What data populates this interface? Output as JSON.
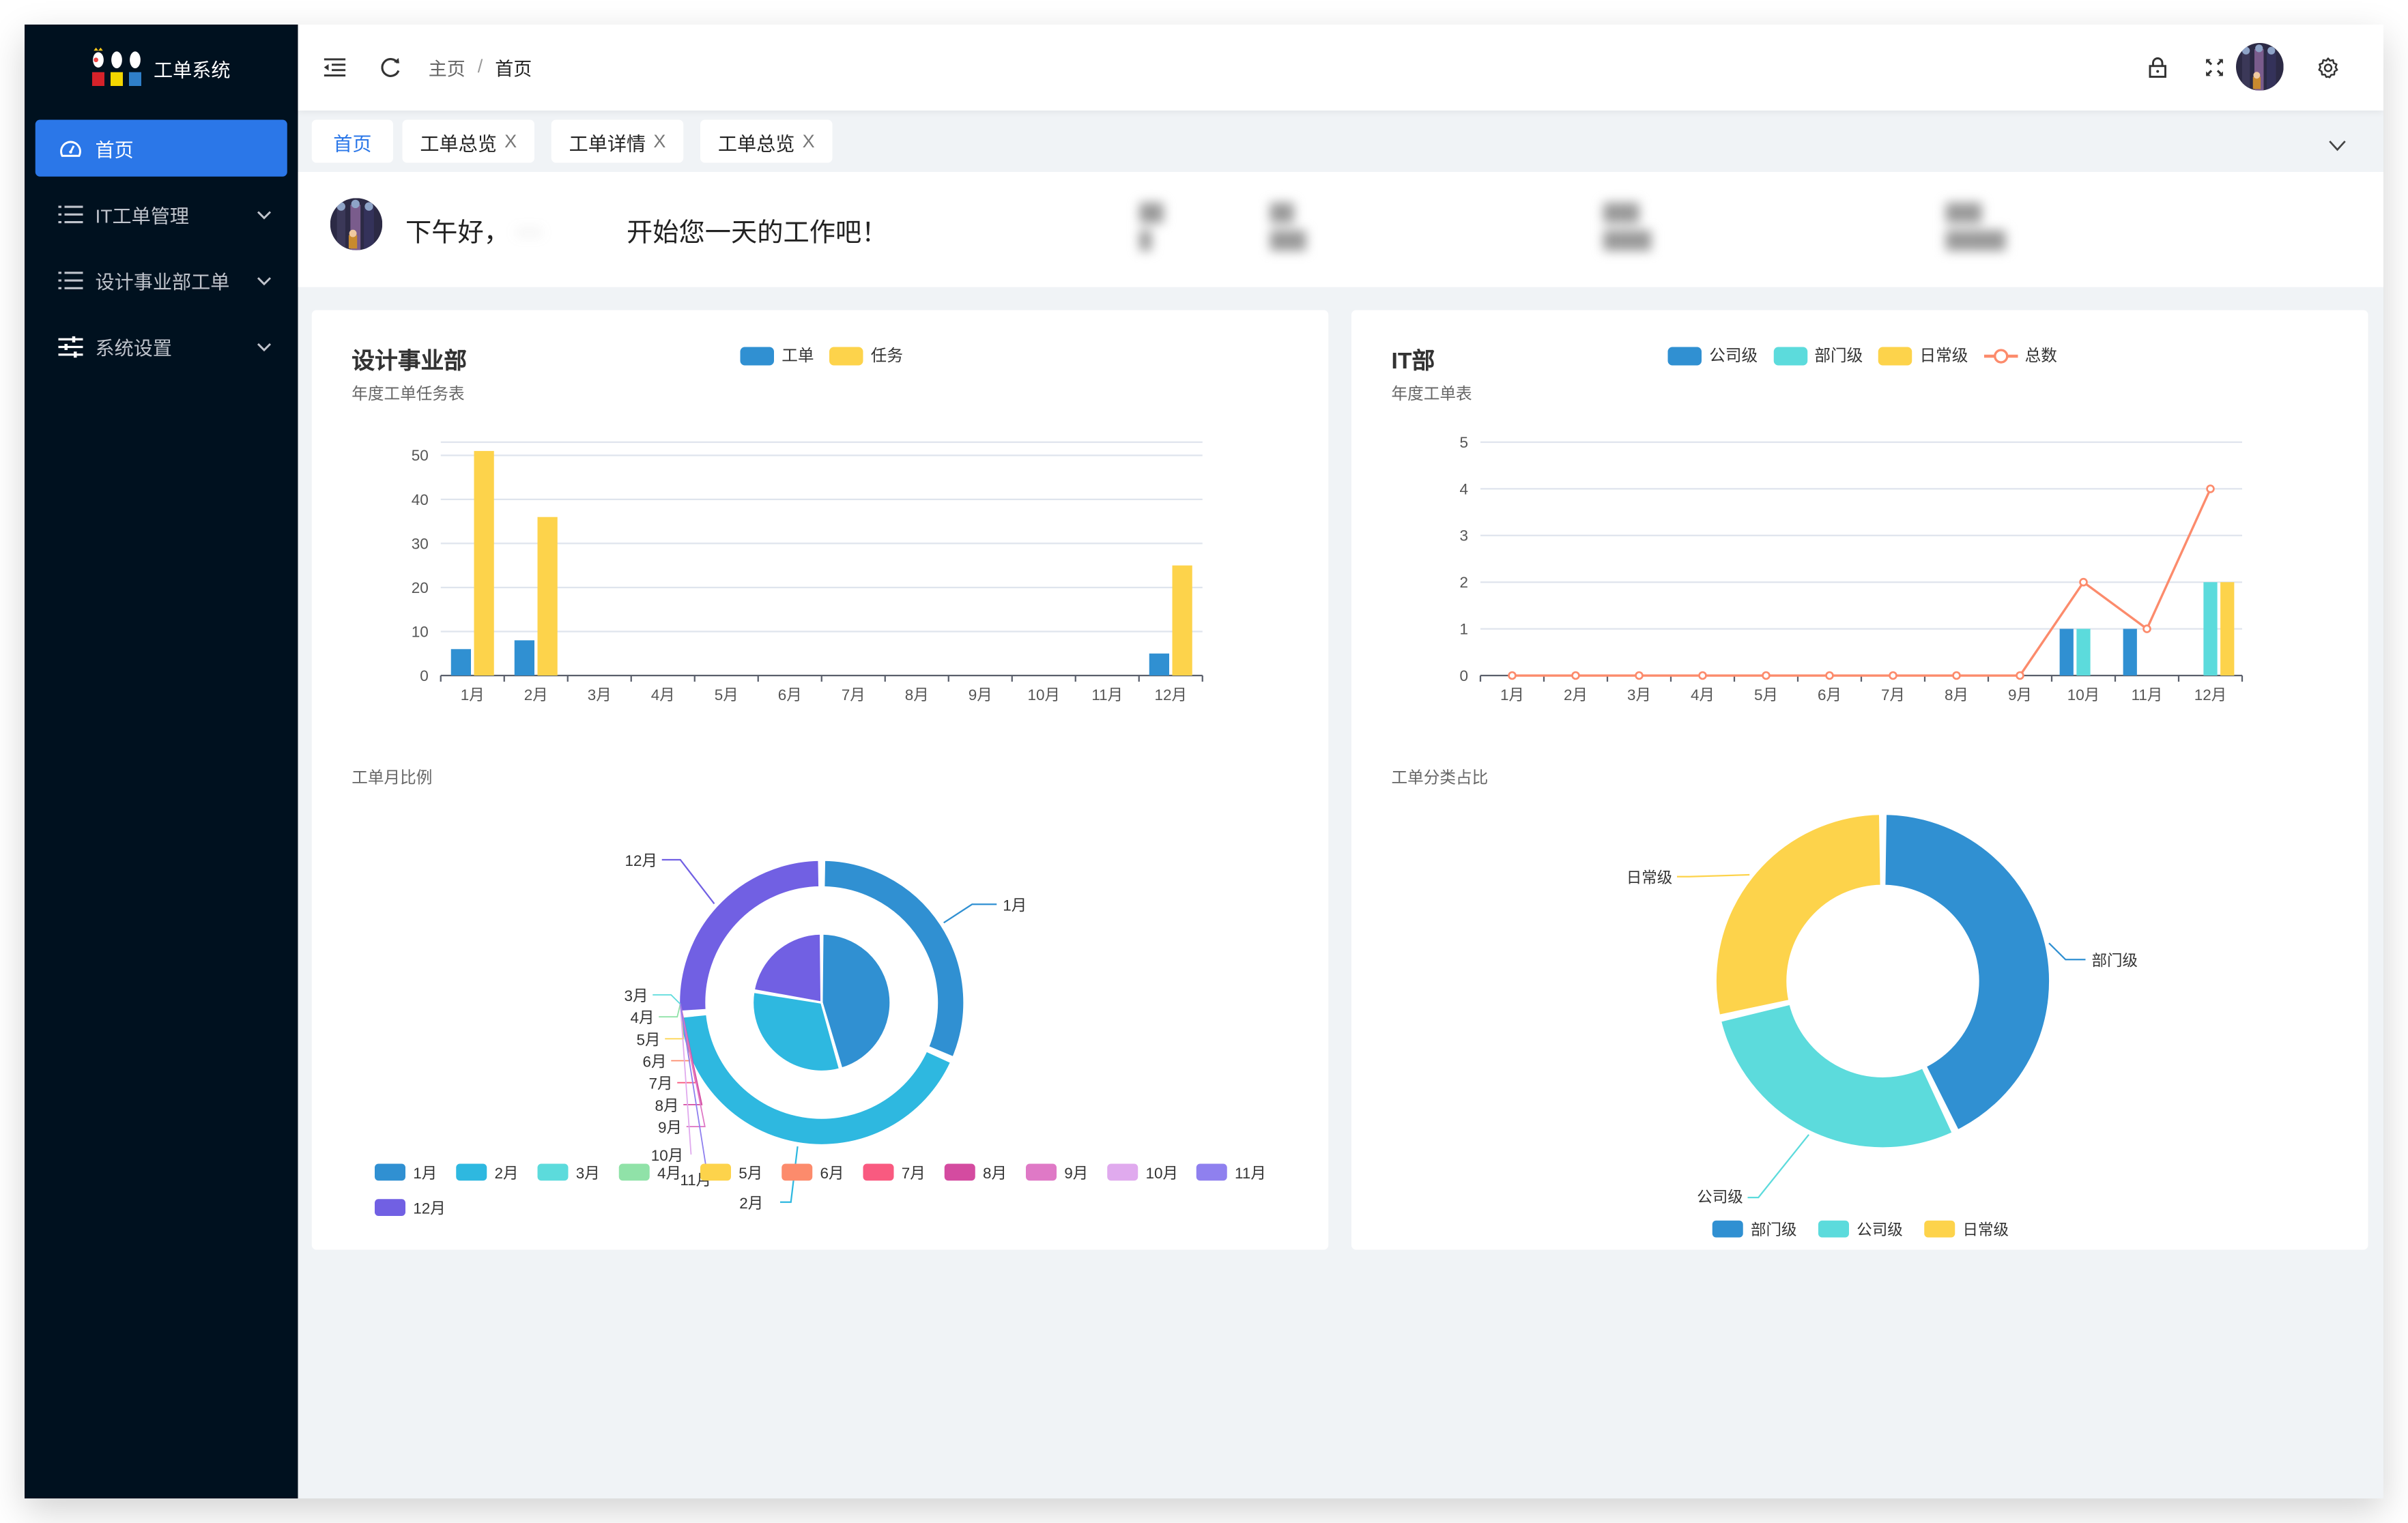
{
  "app": {
    "title": "工单系统"
  },
  "sidebar": {
    "items": [
      {
        "label": "首页",
        "icon": "dashboard-icon",
        "active": true,
        "expandable": false
      },
      {
        "label": "IT工单管理",
        "icon": "list-icon",
        "active": false,
        "expandable": true
      },
      {
        "label": "设计事业部工单",
        "icon": "list-icon",
        "active": false,
        "expandable": true
      },
      {
        "label": "系统设置",
        "icon": "sliders-icon",
        "active": false,
        "expandable": true
      }
    ]
  },
  "header": {
    "breadcrumb": [
      "主页",
      "首页"
    ],
    "separator": "/",
    "icons": [
      "collapse-menu-icon",
      "refresh-icon",
      "lock-icon",
      "fullscreen-icon",
      "avatar",
      "settings-icon"
    ]
  },
  "tabs": [
    {
      "label": "首页",
      "active": true,
      "closable": false
    },
    {
      "label": "工单总览",
      "active": false,
      "closable": true
    },
    {
      "label": "工单详情",
      "active": false,
      "closable": true
    },
    {
      "label": "工单总览",
      "active": false,
      "closable": true
    }
  ],
  "tab_close_glyph": "X",
  "greeting": {
    "prefix": "下午好，",
    "name": "···",
    "suffix": "开始您一天的工作吧！",
    "stats_blurred": true
  },
  "colors": {
    "accent": "#2b77e8",
    "sidebar_bg": "#00111f",
    "blue": "#3090d2",
    "cyan": "#2eb8e0",
    "teal": "#5cdbdc",
    "yellow": "#fdd34b",
    "line": "#fc8b6c",
    "purple": "#7160e3"
  },
  "chart_data": [
    {
      "type": "bar",
      "title": "设计事业部",
      "subtitle": "年度工单任务表",
      "categories": [
        "1月",
        "2月",
        "3月",
        "4月",
        "5月",
        "6月",
        "7月",
        "8月",
        "9月",
        "10月",
        "11月",
        "12月"
      ],
      "series": [
        {
          "name": "工单",
          "color": "#3090d2",
          "values": [
            6,
            8,
            0,
            0,
            0,
            0,
            0,
            0,
            0,
            0,
            0,
            5
          ]
        },
        {
          "name": "任务",
          "color": "#fdd34b",
          "values": [
            51,
            36,
            0,
            0,
            0,
            0,
            0,
            0,
            0,
            0,
            0,
            25
          ]
        }
      ],
      "yticks": [
        0,
        10,
        20,
        30,
        40,
        50
      ],
      "ylim": [
        0,
        53
      ],
      "grid": true,
      "legend": "top-center"
    },
    {
      "type": "bar+line",
      "title": "IT部",
      "subtitle": "年度工单表",
      "categories": [
        "1月",
        "2月",
        "3月",
        "4月",
        "5月",
        "6月",
        "7月",
        "8月",
        "9月",
        "10月",
        "11月",
        "12月"
      ],
      "series": [
        {
          "name": "公司级",
          "kind": "bar",
          "color": "#3090d2",
          "values": [
            0,
            0,
            0,
            0,
            0,
            0,
            0,
            0,
            0,
            1,
            1,
            0
          ]
        },
        {
          "name": "部门级",
          "kind": "bar",
          "color": "#5cdbdc",
          "values": [
            0,
            0,
            0,
            0,
            0,
            0,
            0,
            0,
            0,
            1,
            0,
            2
          ]
        },
        {
          "name": "日常级",
          "kind": "bar",
          "color": "#fdd34b",
          "values": [
            0,
            0,
            0,
            0,
            0,
            0,
            0,
            0,
            0,
            0,
            0,
            2
          ]
        },
        {
          "name": "总数",
          "kind": "line",
          "color": "#fc8b6c",
          "values": [
            0,
            0,
            0,
            0,
            0,
            0,
            0,
            0,
            0,
            2,
            1,
            4
          ]
        }
      ],
      "yticks": [
        0,
        1,
        2,
        3,
        4,
        5
      ],
      "ylim": [
        0,
        5
      ],
      "grid": true,
      "legend": "top-center"
    },
    {
      "type": "pie",
      "title": "工单月比例",
      "inner": {
        "name": "任务",
        "values": [
          51,
          36,
          0,
          0,
          0,
          0,
          0,
          0,
          0,
          0,
          0,
          25
        ]
      },
      "outer": {
        "name": "工单",
        "values": [
          6,
          8,
          0,
          0,
          0,
          0,
          0,
          0,
          0,
          0,
          0,
          5
        ]
      },
      "labels": [
        "1月",
        "2月",
        "3月",
        "4月",
        "5月",
        "6月",
        "7月",
        "8月",
        "9月",
        "10月",
        "11月",
        "12月"
      ],
      "colors": [
        "#3090d2",
        "#2eb8e0",
        "#5cdbdc",
        "#90e2a8",
        "#fdd34b",
        "#fc8b6c",
        "#f95a80",
        "#d44ba0",
        "#df79c6",
        "#e0aaee",
        "#8f80ef",
        "#7160e3"
      ],
      "legend": "bottom"
    },
    {
      "type": "pie",
      "title": "工单分类占比",
      "labels": [
        "部门级",
        "公司级",
        "日常级"
      ],
      "values": [
        3,
        2,
        2
      ],
      "colors": [
        "#3090d2",
        "#5cdbdc",
        "#fdd34b"
      ],
      "donut": true,
      "legend": "bottom"
    }
  ]
}
